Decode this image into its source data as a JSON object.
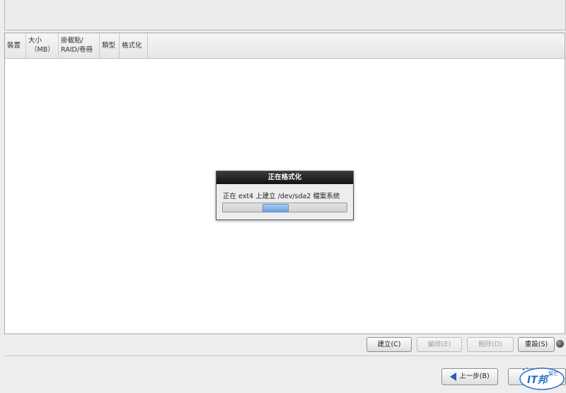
{
  "table": {
    "columns": [
      {
        "line1": "裝置",
        "line2": ""
      },
      {
        "line1": "大小",
        "line2": "（MB）"
      },
      {
        "line1": "掛載點/",
        "line2": "RAID/卷冊"
      },
      {
        "line1": "類型",
        "line2": ""
      },
      {
        "line1": "格式化",
        "line2": ""
      }
    ]
  },
  "dialog": {
    "title": "正在格式化",
    "message": "正在 ext4 上建立 /dev/sda2 檔案系統",
    "progress_state": "indeterminate"
  },
  "actions": {
    "create": "建立(C)",
    "edit": "編修(E)",
    "delete": "刪除(D)",
    "reset": "重設(S)"
  },
  "nav": {
    "back": "上一步(B)"
  },
  "watermark": {
    "brand": "IT邦",
    "sub": "幫忙",
    "accent": "#2a6fc9"
  }
}
